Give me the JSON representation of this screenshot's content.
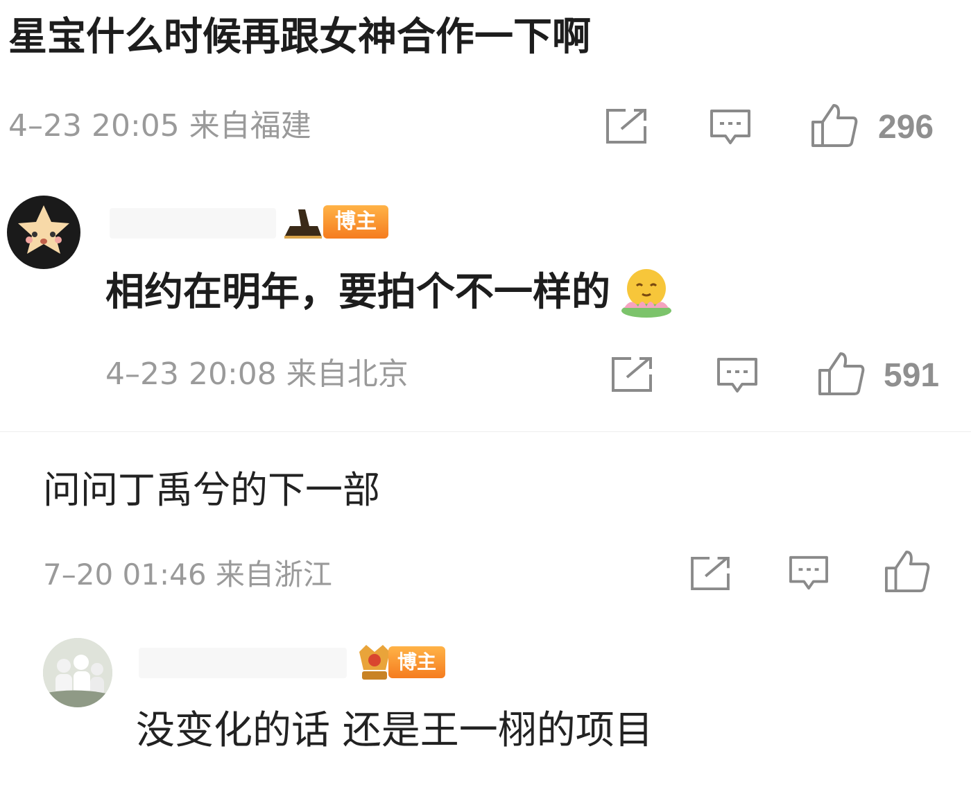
{
  "comments": [
    {
      "text": "星宝什么时候再跟女神合作一下啊",
      "meta": "4–23 20:05 来自福建",
      "likes": "296"
    },
    {
      "badge": "博主",
      "text": "相约在明年，要拍个不一样的",
      "emoji": "lotus-smile-emoji",
      "meta": "4–23 20:08 来自北京",
      "likes": "591"
    },
    {
      "text": "问问丁禹兮的下一部",
      "meta": "7–20 01:46 来自浙江",
      "likes": ""
    },
    {
      "badge": "博主",
      "text": "没变化的话 还是王一栩的项目"
    }
  ],
  "icons": {
    "share": "share-icon",
    "comment": "comment-icon",
    "like": "thumbs-up-icon"
  },
  "colors": {
    "badge_orange": "#f57c1f",
    "meta_gray": "#9a9a9a",
    "icon_gray": "#8a8a8a"
  }
}
